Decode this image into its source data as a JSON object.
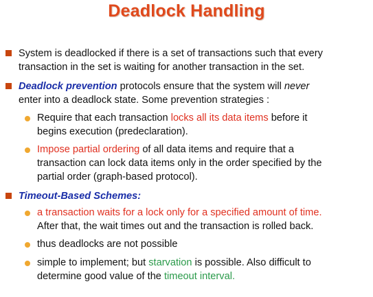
{
  "title": "Deadlock Handling",
  "colors": {
    "title": "#e0491c",
    "square_bullet": "#c8460f",
    "round_bullet": "#f0a830",
    "emphasis_blue": "#1a2ea8",
    "emphasis_red": "#e03020",
    "emphasis_green": "#2a9a4a"
  },
  "bullets": {
    "b1": {
      "l1": "System is deadlocked if there is a set of transactions such that every",
      "l2": "transaction in the set is waiting for another transaction in the set."
    },
    "b2": {
      "l1_term": "Deadlock prevention",
      "l1_a": " protocols ensure that the system will ",
      "l1_never": "never",
      "l2": "enter into a deadlock state. Some prevention strategies :",
      "s1": {
        "l1_a": "Require that each transaction ",
        "l1_red": "locks all its data items",
        "l1_b": " before it",
        "l2": "begins execution (predeclaration)."
      },
      "s2": {
        "l1_red": "Impose partial ordering",
        "l1_b": " of all data items and require that a",
        "l2": "transaction can lock data items only in the order specified by the",
        "l3": "partial order (graph-based protocol)."
      }
    },
    "b3": {
      "term": "Timeout-Based Schemes:",
      "s1": {
        "l1_red": "a transaction waits for a lock only for a specified amount of time.",
        "l2": "After that, the wait times out and the transaction is rolled back."
      },
      "s2": {
        "l1": "thus deadlocks are not possible"
      },
      "s3": {
        "l1_a": "simple to implement; but ",
        "l1_green": "starvation",
        "l1_b": " is possible. Also difficult to",
        "l2_a": "determine good value of the ",
        "l2_green": "timeout interval."
      }
    }
  }
}
